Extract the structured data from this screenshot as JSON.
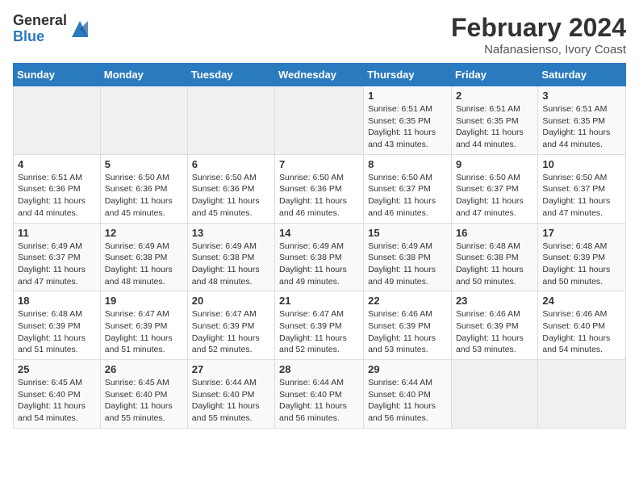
{
  "logo": {
    "general": "General",
    "blue": "Blue"
  },
  "title": "February 2024",
  "location": "Nafanasienso, Ivory Coast",
  "weekdays": [
    "Sunday",
    "Monday",
    "Tuesday",
    "Wednesday",
    "Thursday",
    "Friday",
    "Saturday"
  ],
  "weeks": [
    [
      {
        "day": "",
        "info": ""
      },
      {
        "day": "",
        "info": ""
      },
      {
        "day": "",
        "info": ""
      },
      {
        "day": "",
        "info": ""
      },
      {
        "day": "1",
        "info": "Sunrise: 6:51 AM\nSunset: 6:35 PM\nDaylight: 11 hours\nand 43 minutes."
      },
      {
        "day": "2",
        "info": "Sunrise: 6:51 AM\nSunset: 6:35 PM\nDaylight: 11 hours\nand 44 minutes."
      },
      {
        "day": "3",
        "info": "Sunrise: 6:51 AM\nSunset: 6:35 PM\nDaylight: 11 hours\nand 44 minutes."
      }
    ],
    [
      {
        "day": "4",
        "info": "Sunrise: 6:51 AM\nSunset: 6:36 PM\nDaylight: 11 hours\nand 44 minutes."
      },
      {
        "day": "5",
        "info": "Sunrise: 6:50 AM\nSunset: 6:36 PM\nDaylight: 11 hours\nand 45 minutes."
      },
      {
        "day": "6",
        "info": "Sunrise: 6:50 AM\nSunset: 6:36 PM\nDaylight: 11 hours\nand 45 minutes."
      },
      {
        "day": "7",
        "info": "Sunrise: 6:50 AM\nSunset: 6:36 PM\nDaylight: 11 hours\nand 46 minutes."
      },
      {
        "day": "8",
        "info": "Sunrise: 6:50 AM\nSunset: 6:37 PM\nDaylight: 11 hours\nand 46 minutes."
      },
      {
        "day": "9",
        "info": "Sunrise: 6:50 AM\nSunset: 6:37 PM\nDaylight: 11 hours\nand 47 minutes."
      },
      {
        "day": "10",
        "info": "Sunrise: 6:50 AM\nSunset: 6:37 PM\nDaylight: 11 hours\nand 47 minutes."
      }
    ],
    [
      {
        "day": "11",
        "info": "Sunrise: 6:49 AM\nSunset: 6:37 PM\nDaylight: 11 hours\nand 47 minutes."
      },
      {
        "day": "12",
        "info": "Sunrise: 6:49 AM\nSunset: 6:38 PM\nDaylight: 11 hours\nand 48 minutes."
      },
      {
        "day": "13",
        "info": "Sunrise: 6:49 AM\nSunset: 6:38 PM\nDaylight: 11 hours\nand 48 minutes."
      },
      {
        "day": "14",
        "info": "Sunrise: 6:49 AM\nSunset: 6:38 PM\nDaylight: 11 hours\nand 49 minutes."
      },
      {
        "day": "15",
        "info": "Sunrise: 6:49 AM\nSunset: 6:38 PM\nDaylight: 11 hours\nand 49 minutes."
      },
      {
        "day": "16",
        "info": "Sunrise: 6:48 AM\nSunset: 6:38 PM\nDaylight: 11 hours\nand 50 minutes."
      },
      {
        "day": "17",
        "info": "Sunrise: 6:48 AM\nSunset: 6:39 PM\nDaylight: 11 hours\nand 50 minutes."
      }
    ],
    [
      {
        "day": "18",
        "info": "Sunrise: 6:48 AM\nSunset: 6:39 PM\nDaylight: 11 hours\nand 51 minutes."
      },
      {
        "day": "19",
        "info": "Sunrise: 6:47 AM\nSunset: 6:39 PM\nDaylight: 11 hours\nand 51 minutes."
      },
      {
        "day": "20",
        "info": "Sunrise: 6:47 AM\nSunset: 6:39 PM\nDaylight: 11 hours\nand 52 minutes."
      },
      {
        "day": "21",
        "info": "Sunrise: 6:47 AM\nSunset: 6:39 PM\nDaylight: 11 hours\nand 52 minutes."
      },
      {
        "day": "22",
        "info": "Sunrise: 6:46 AM\nSunset: 6:39 PM\nDaylight: 11 hours\nand 53 minutes."
      },
      {
        "day": "23",
        "info": "Sunrise: 6:46 AM\nSunset: 6:39 PM\nDaylight: 11 hours\nand 53 minutes."
      },
      {
        "day": "24",
        "info": "Sunrise: 6:46 AM\nSunset: 6:40 PM\nDaylight: 11 hours\nand 54 minutes."
      }
    ],
    [
      {
        "day": "25",
        "info": "Sunrise: 6:45 AM\nSunset: 6:40 PM\nDaylight: 11 hours\nand 54 minutes."
      },
      {
        "day": "26",
        "info": "Sunrise: 6:45 AM\nSunset: 6:40 PM\nDaylight: 11 hours\nand 55 minutes."
      },
      {
        "day": "27",
        "info": "Sunrise: 6:44 AM\nSunset: 6:40 PM\nDaylight: 11 hours\nand 55 minutes."
      },
      {
        "day": "28",
        "info": "Sunrise: 6:44 AM\nSunset: 6:40 PM\nDaylight: 11 hours\nand 56 minutes."
      },
      {
        "day": "29",
        "info": "Sunrise: 6:44 AM\nSunset: 6:40 PM\nDaylight: 11 hours\nand 56 minutes."
      },
      {
        "day": "",
        "info": ""
      },
      {
        "day": "",
        "info": ""
      }
    ]
  ]
}
